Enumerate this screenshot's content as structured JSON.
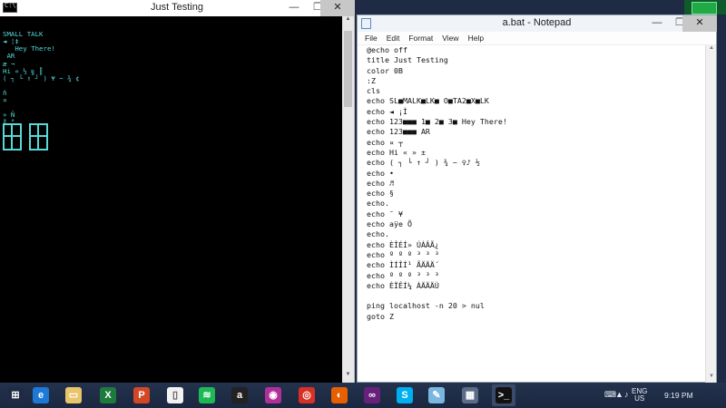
{
  "console": {
    "title": "Just Testing",
    "min_glyph": "—",
    "max_glyph": "❐",
    "close_glyph": "✕",
    "lines": [
      "SMALL TALK",
      "◄ ¦‡",
      "   Hey There!",
      " AR",
      "æ ¬",
      "Hi « ½ ╗ ║",
      "( ┐ └ ↑ ┘ ) ¥ ~ ¾ ¢",
      "",
      "ñ",
      "¤",
      "",
      "» Ñ",
      "ª °"
    ]
  },
  "notepad": {
    "title": "a.bat - Notepad",
    "min_glyph": "—",
    "max_glyph": "❐",
    "close_glyph": "✕",
    "menu": [
      "File",
      "Edit",
      "Format",
      "View",
      "Help"
    ],
    "lines": [
      "@echo off",
      "title Just Testing",
      "color 0B",
      ":Z",
      "cls",
      "echo SL■MALK■LK■ O■TA2■X■LK",
      "echo ◄ ¡Ì",
      "echo 123■■■ 1■ 2■ 3■ Hey There!",
      "echo 123■■■ AR",
      "echo ¤ ┬",
      "echo Hi « » ±",
      "echo ( ┐ └ ↑ ┘ ) ¾ ~ ♀♪ ½",
      "echo •",
      "echo ♬",
      "echo §",
      "echo.",
      "echo ¯ ¥",
      "echo aÿe Õ",
      "echo.",
      "echo ÈÎÉÍ» ÚÀÂÃ¿",
      "echo º º º ³ ³ ³",
      "echo ÌÍÎÍ¹ ÃÄÄÄ´",
      "echo º º º ³ ³ ³",
      "echo ÈÏÊÍ¼ ÀÄÄÄÙ",
      "",
      "ping localhost -n 20 > nul",
      "goto Z"
    ]
  },
  "taskbar": {
    "apps": [
      {
        "name": "windows-start-icon",
        "glyph": "⊞",
        "color": "#1f2a44"
      },
      {
        "name": "internet-explorer-icon",
        "glyph": "e",
        "color": "#1e78d6"
      },
      {
        "name": "file-explorer-icon",
        "glyph": "▭",
        "color": "#e9c46a"
      },
      {
        "name": "excel-icon",
        "glyph": "X",
        "color": "#1e7a3c"
      },
      {
        "name": "powerpoint-icon",
        "glyph": "P",
        "color": "#d24726"
      },
      {
        "name": "document-icon",
        "glyph": "▯",
        "color": "#f2f2f2"
      },
      {
        "name": "spotify-icon",
        "glyph": "≋",
        "color": "#1db954"
      },
      {
        "name": "amazon-icon",
        "glyph": "a",
        "color": "#222222"
      },
      {
        "name": "photo-icon",
        "glyph": "◉",
        "color": "#b0309a"
      },
      {
        "name": "chrome-icon",
        "glyph": "◎",
        "color": "#d93025"
      },
      {
        "name": "firefox-icon",
        "glyph": "◐",
        "color": "#e66000"
      },
      {
        "name": "visual-studio-icon",
        "glyph": "∞",
        "color": "#68217a"
      },
      {
        "name": "skype-icon",
        "glyph": "S",
        "color": "#00aff0"
      },
      {
        "name": "notepad-icon",
        "glyph": "✎",
        "color": "#7ab7e0"
      },
      {
        "name": "calculator-icon",
        "glyph": "▦",
        "color": "#5b6d86"
      },
      {
        "name": "command-prompt-icon",
        "glyph": ">_",
        "color": "#111111"
      }
    ],
    "tray": {
      "lang_top": "ENG",
      "lang_bottom": "US",
      "time": "9:19 PM"
    }
  }
}
